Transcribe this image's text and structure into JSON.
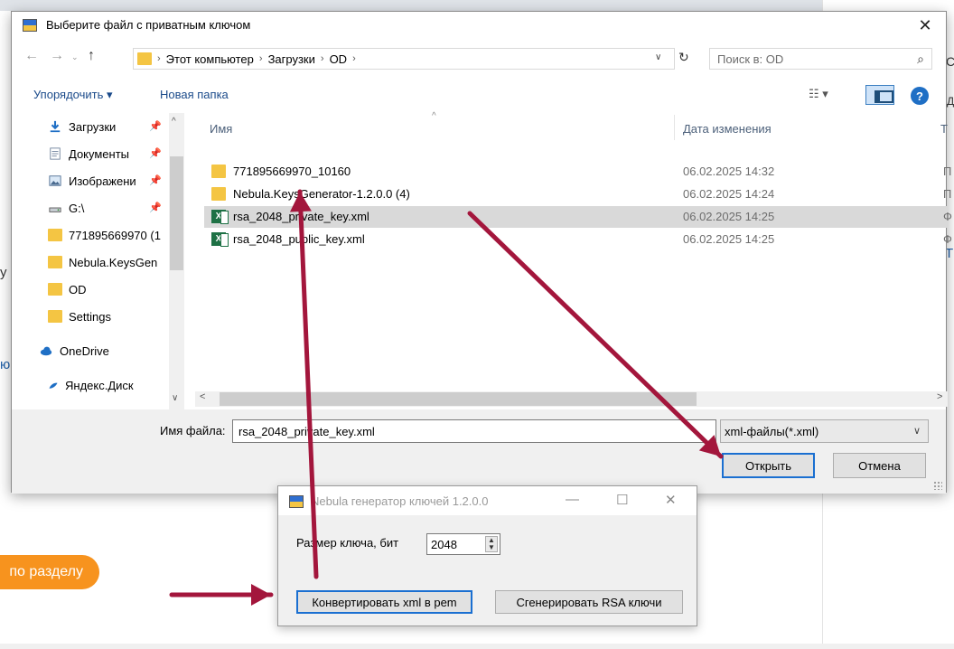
{
  "background": {
    "left_button_label": "по разделу",
    "fragments": [
      "у",
      "ю",
      "Т",
      "Д",
      "С"
    ]
  },
  "dialog": {
    "title": "Выберите файл с приватным ключом",
    "breadcrumbs": [
      "Этот компьютер",
      "Загрузки",
      "OD"
    ],
    "search_placeholder": "Поиск в: OD",
    "toolbar": {
      "organize": "Упорядочить ▾",
      "new_folder": "Новая папка"
    },
    "nav": [
      {
        "label": "Загрузки",
        "icon": "download-icon",
        "pinned": true
      },
      {
        "label": "Документы",
        "icon": "documents-icon",
        "pinned": true
      },
      {
        "label": "Изображени",
        "icon": "pictures-icon",
        "pinned": true
      },
      {
        "label": "G:\\",
        "icon": "drive-icon",
        "pinned": true
      },
      {
        "label": "771895669970 (1",
        "icon": "folder-icon",
        "pinned": false
      },
      {
        "label": "Nebula.KeysGen",
        "icon": "folder-icon",
        "pinned": false
      },
      {
        "label": "OD",
        "icon": "folder-icon",
        "pinned": false
      },
      {
        "label": "Settings",
        "icon": "folder-icon",
        "pinned": false
      },
      {
        "label": "OneDrive",
        "icon": "onedrive-icon",
        "pinned": false
      },
      {
        "label": "Яндекс.Диск",
        "icon": "yandex-disk-icon",
        "pinned": false
      }
    ],
    "columns": {
      "name": "Имя",
      "date": "Дата изменения",
      "type": "Т"
    },
    "files": [
      {
        "name": "771895669970_10160",
        "date": "06.02.2025 14:32",
        "type": "П",
        "icon": "folder-icon",
        "selected": false
      },
      {
        "name": "Nebula.KeysGenerator-1.2.0.0 (4)",
        "date": "06.02.2025 14:24",
        "type": "П",
        "icon": "folder-icon",
        "selected": false
      },
      {
        "name": "rsa_2048_private_key.xml",
        "date": "06.02.2025 14:25",
        "type": "Ф",
        "icon": "excel-xml-icon",
        "selected": true
      },
      {
        "name": "rsa_2048_public_key.xml",
        "date": "06.02.2025 14:25",
        "type": "Ф",
        "icon": "excel-xml-icon",
        "selected": false
      }
    ],
    "filename_label": "Имя файла:",
    "filename_value": "rsa_2048_private_key.xml",
    "filetype": "xml-файлы(*.xml)",
    "open_label": "Открыть",
    "cancel_label": "Отмена"
  },
  "nebula": {
    "title": "Nebula генератор ключей 1.2.0.0",
    "key_size_label": "Размер ключа, бит",
    "key_size_value": "2048",
    "convert_label": "Конвертировать xml в pem",
    "generate_label": "Сгенерировать RSA ключи"
  },
  "annotation_color": "#a3163c"
}
